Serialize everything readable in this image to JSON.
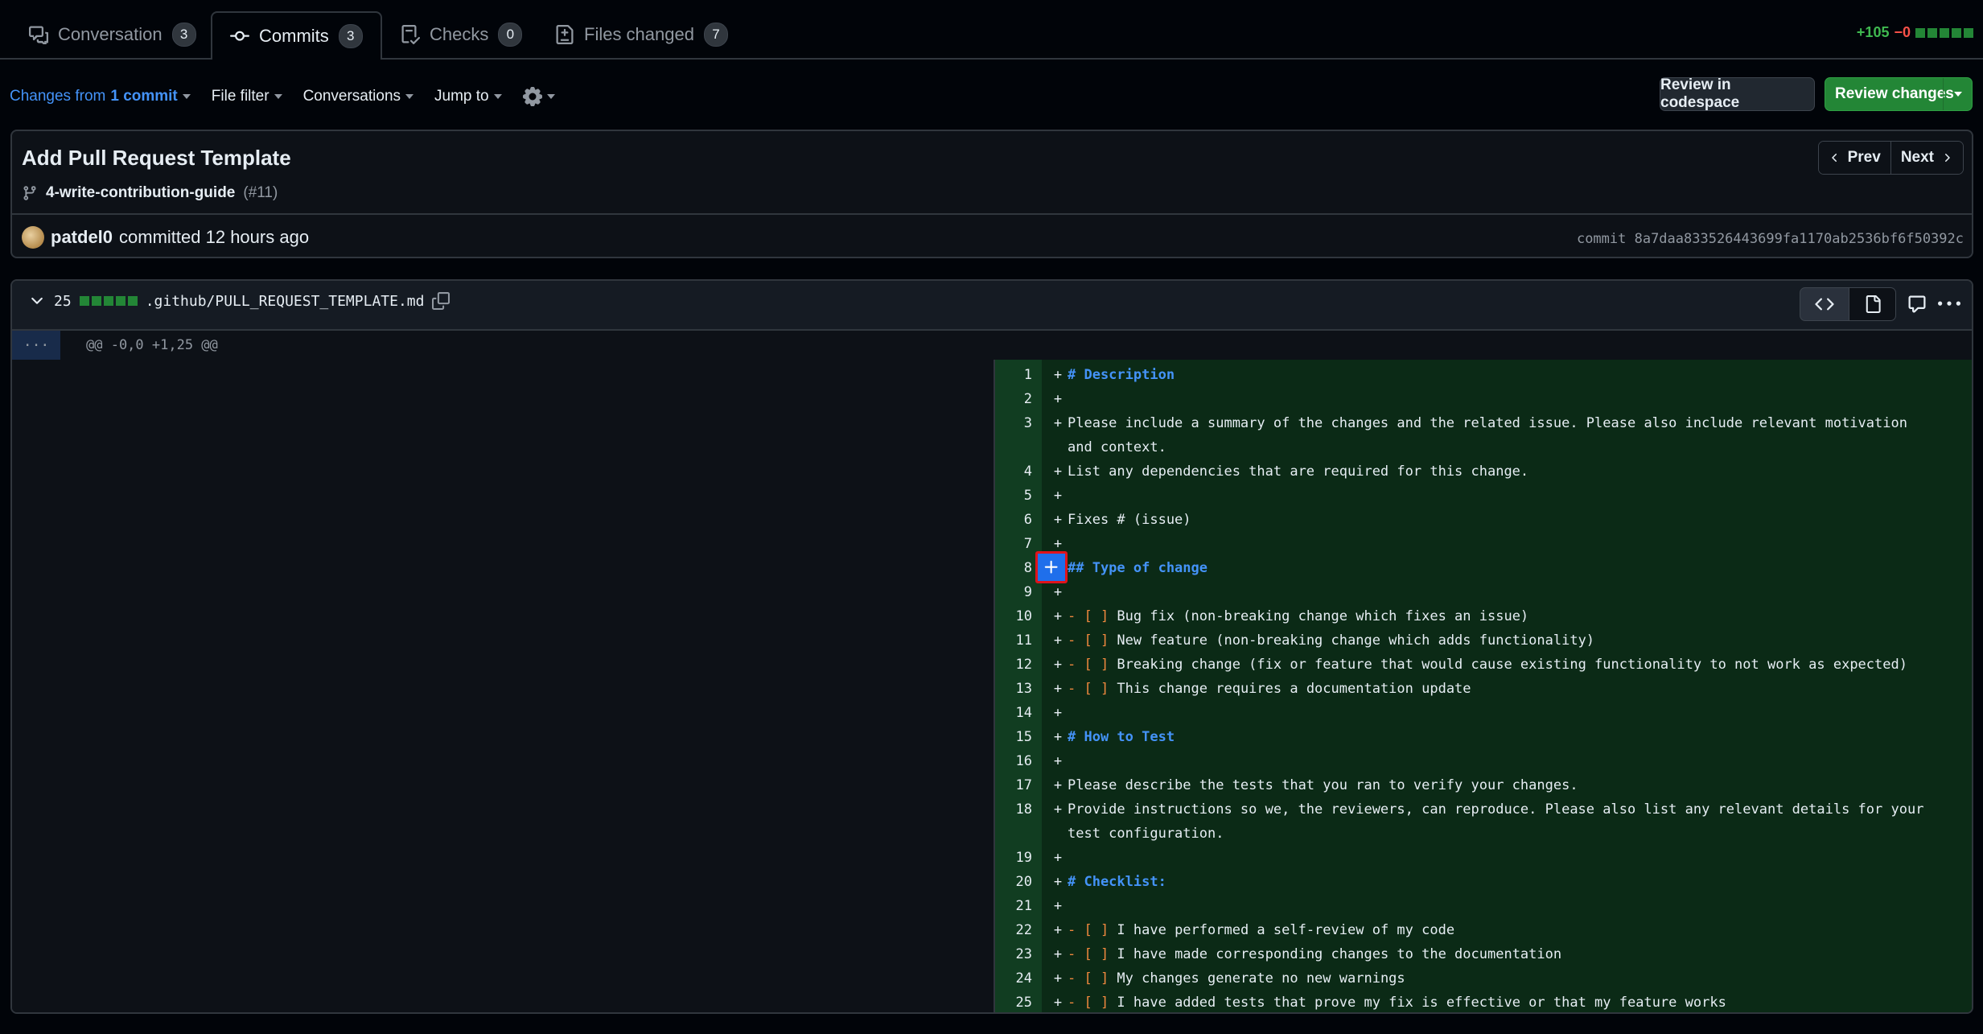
{
  "tabs": [
    {
      "label": "Conversation",
      "count": "3"
    },
    {
      "label": "Commits",
      "count": "3"
    },
    {
      "label": "Checks",
      "count": "0"
    },
    {
      "label": "Files changed",
      "count": "7"
    }
  ],
  "diffstat": {
    "additions": "+105",
    "deletions": "−0"
  },
  "toolbar": {
    "changes_prefix": "Changes from",
    "changes_link": "1 commit",
    "file_filter": "File filter",
    "conversations": "Conversations",
    "jump_to": "Jump to"
  },
  "actions": {
    "codespace": "Review in codespace",
    "review": "Review changes"
  },
  "commit": {
    "title": "Add Pull Request Template",
    "branch": "4-write-contribution-guide",
    "pr_number": "(#11)",
    "author": "patdel0",
    "committed_text": "committed 12 hours ago",
    "sha_text": "commit 8a7daa833526443699fa1170ab2536bf6f50392c",
    "prev": "Prev",
    "next": "Next"
  },
  "file": {
    "changes": "25",
    "path": ".github/PULL_REQUEST_TEMPLATE.md",
    "hunk_expander": "...",
    "hunk_header": "@@ -0,0 +1,25 @@"
  },
  "diff_lines": [
    {
      "n": "1",
      "t": "# Description",
      "k": "h"
    },
    {
      "n": "2",
      "t": "",
      "k": ""
    },
    {
      "n": "3",
      "t": "Please include a summary of the changes and the related issue. Please also include relevant motivation and context.",
      "k": ""
    },
    {
      "n": "4",
      "t": "List any dependencies that are required for this change.",
      "k": ""
    },
    {
      "n": "5",
      "t": "",
      "k": ""
    },
    {
      "n": "6",
      "t": "Fixes # (issue)",
      "k": ""
    },
    {
      "n": "7",
      "t": "",
      "k": ""
    },
    {
      "n": "8",
      "t": "## Type of change",
      "k": "h"
    },
    {
      "n": "9",
      "t": "",
      "k": ""
    },
    {
      "n": "10",
      "t": "Bug fix (non-breaking change which fixes an issue)",
      "k": "c"
    },
    {
      "n": "11",
      "t": "New feature (non-breaking change which adds functionality)",
      "k": "c"
    },
    {
      "n": "12",
      "t": "Breaking change (fix or feature that would cause existing functionality to not work as expected)",
      "k": "c"
    },
    {
      "n": "13",
      "t": "This change requires a documentation update",
      "k": "c"
    },
    {
      "n": "14",
      "t": "",
      "k": ""
    },
    {
      "n": "15",
      "t": "# How to Test",
      "k": "h"
    },
    {
      "n": "16",
      "t": "",
      "k": ""
    },
    {
      "n": "17",
      "t": "Please describe the tests that you ran to verify your changes.",
      "k": ""
    },
    {
      "n": "18",
      "t": "Provide instructions so we, the reviewers, can reproduce. Please also list any relevant details for your test configuration.",
      "k": ""
    },
    {
      "n": "19",
      "t": "",
      "k": ""
    },
    {
      "n": "20",
      "t": "# Checklist:",
      "k": "h"
    },
    {
      "n": "21",
      "t": "",
      "k": ""
    },
    {
      "n": "22",
      "t": "I have performed a self-review of my code",
      "k": "c"
    },
    {
      "n": "23",
      "t": "I have made corresponding changes to the documentation",
      "k": "c"
    },
    {
      "n": "24",
      "t": "My changes generate no new warnings",
      "k": "c"
    },
    {
      "n": "25",
      "t": "I have added tests that prove my fix is effective or that my feature works",
      "k": "c"
    }
  ],
  "diff_sign": "+",
  "checkbox_prefix": "- [ ]",
  "colors": {
    "accent": "#4493f8",
    "add": "#3fb950",
    "delete": "#f85149",
    "highlight_border": "#e0131b"
  }
}
